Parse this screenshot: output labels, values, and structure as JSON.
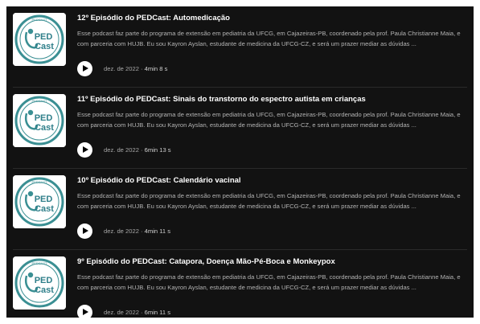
{
  "colors": {
    "background": "#121212",
    "title": "#ffffff",
    "description": "#b3b3b3",
    "meta": "#a7a7a7",
    "logo_teal": "#3a8f93",
    "logo_text": "#2f7f8a"
  },
  "episodes": [
    {
      "title": "12º Episódio do PEDCast: Automedicação",
      "description": "Esse podcast faz parte do programa de extensão em pediatria da UFCG, em Cajazeiras-PB, coordenado pela prof. Paula Christianne Maia, e com parceria com HUJB. Eu sou Kayron Ayslan, estudante de medicina da UFCG-CZ, e será um prazer mediar as dúvidas ...",
      "date": "dez. de 2022",
      "separator": " · ",
      "duration": "4min 8 s",
      "cover": {
        "top_text": "PEDCAST",
        "logo_line1": "PED",
        "logo_line2": "Cast",
        "icon": "stethoscope-logo-icon"
      }
    },
    {
      "title": "11º Episódio do PEDCast: Sinais do transtorno do espectro autista em crianças",
      "description": "Esse podcast faz parte do programa de extensão em pediatria da UFCG, em Cajazeiras-PB, coordenado pela prof. Paula Christianne Maia, e com parceria com HUJB. Eu sou Kayron Ayslan, estudante de medicina da UFCG-CZ, e será um prazer mediar as dúvidas ...",
      "date": "dez. de 2022",
      "separator": " · ",
      "duration": "6min 13 s",
      "cover": {
        "top_text": "PEDCAST",
        "logo_line1": "PED",
        "logo_line2": "Cast",
        "icon": "stethoscope-logo-icon"
      }
    },
    {
      "title": "10º Episódio do PEDCast: Calendário vacinal",
      "description": "Esse podcast faz parte do programa de extensão em pediatria da UFCG, em Cajazeiras-PB, coordenado pela prof. Paula Christianne Maia, e com parceria com HUJB. Eu sou Kayron Ayslan, estudante de medicina da UFCG-CZ, e será um prazer mediar as dúvidas ...",
      "date": "dez. de 2022",
      "separator": " · ",
      "duration": "4min 11 s",
      "cover": {
        "top_text": "PEDCAST",
        "logo_line1": "PED",
        "logo_line2": "Cast",
        "icon": "stethoscope-logo-icon"
      }
    },
    {
      "title": "9º Episódio do PEDCast: Catapora, Doença Mão-Pé-Boca e Monkeypox",
      "description": "Esse podcast faz parte do programa de extensão em pediatria da UFCG, em Cajazeiras-PB, coordenado pela prof. Paula Christianne Maia, e com parceria com HUJB. Eu sou Kayron Ayslan, estudante de medicina da UFCG-CZ, e será um prazer mediar as dúvidas ...",
      "date": "dez. de 2022",
      "separator": " · ",
      "duration": "6min 11 s",
      "cover": {
        "top_text": "PEDCAST",
        "logo_line1": "PED",
        "logo_line2": "Cast",
        "icon": "stethoscope-logo-icon"
      }
    }
  ]
}
